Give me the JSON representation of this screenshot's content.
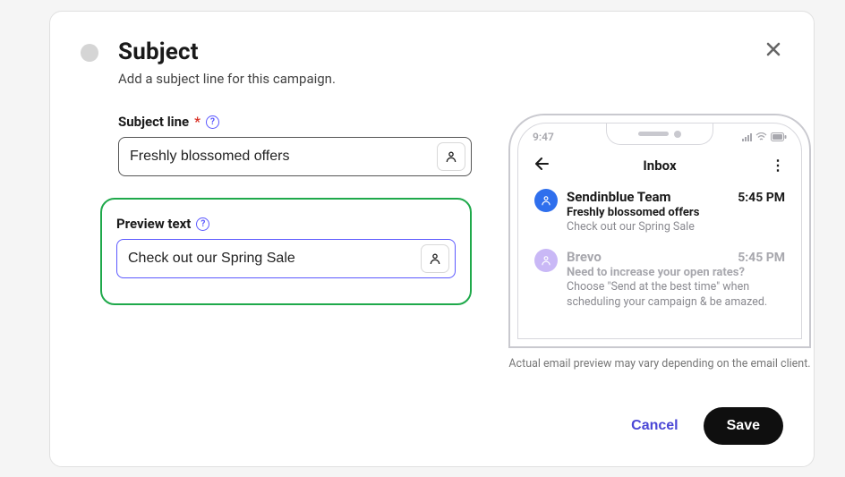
{
  "modal": {
    "title": "Subject",
    "subtitle": "Add a subject line for this campaign."
  },
  "form": {
    "subject": {
      "label": "Subject line",
      "required_marker": "*",
      "value": "Freshly blossomed offers"
    },
    "preview": {
      "label": "Preview text",
      "value": "Check out our Spring Sale"
    }
  },
  "phone": {
    "clock": "9:47",
    "inbox_title": "Inbox",
    "emails": [
      {
        "sender": "Sendinblue Team",
        "time": "5:45 PM",
        "subject": "Freshly blossomed offers",
        "preview": "Check out our Spring Sale"
      },
      {
        "sender": "Brevo",
        "time": "5:45 PM",
        "subject": "Need to increase your open rates?",
        "preview": "Choose \"Send at the best time\" when scheduling your campaign & be amazed."
      }
    ],
    "note": "Actual email preview may vary depending on the email client."
  },
  "footer": {
    "cancel": "Cancel",
    "save": "Save"
  }
}
